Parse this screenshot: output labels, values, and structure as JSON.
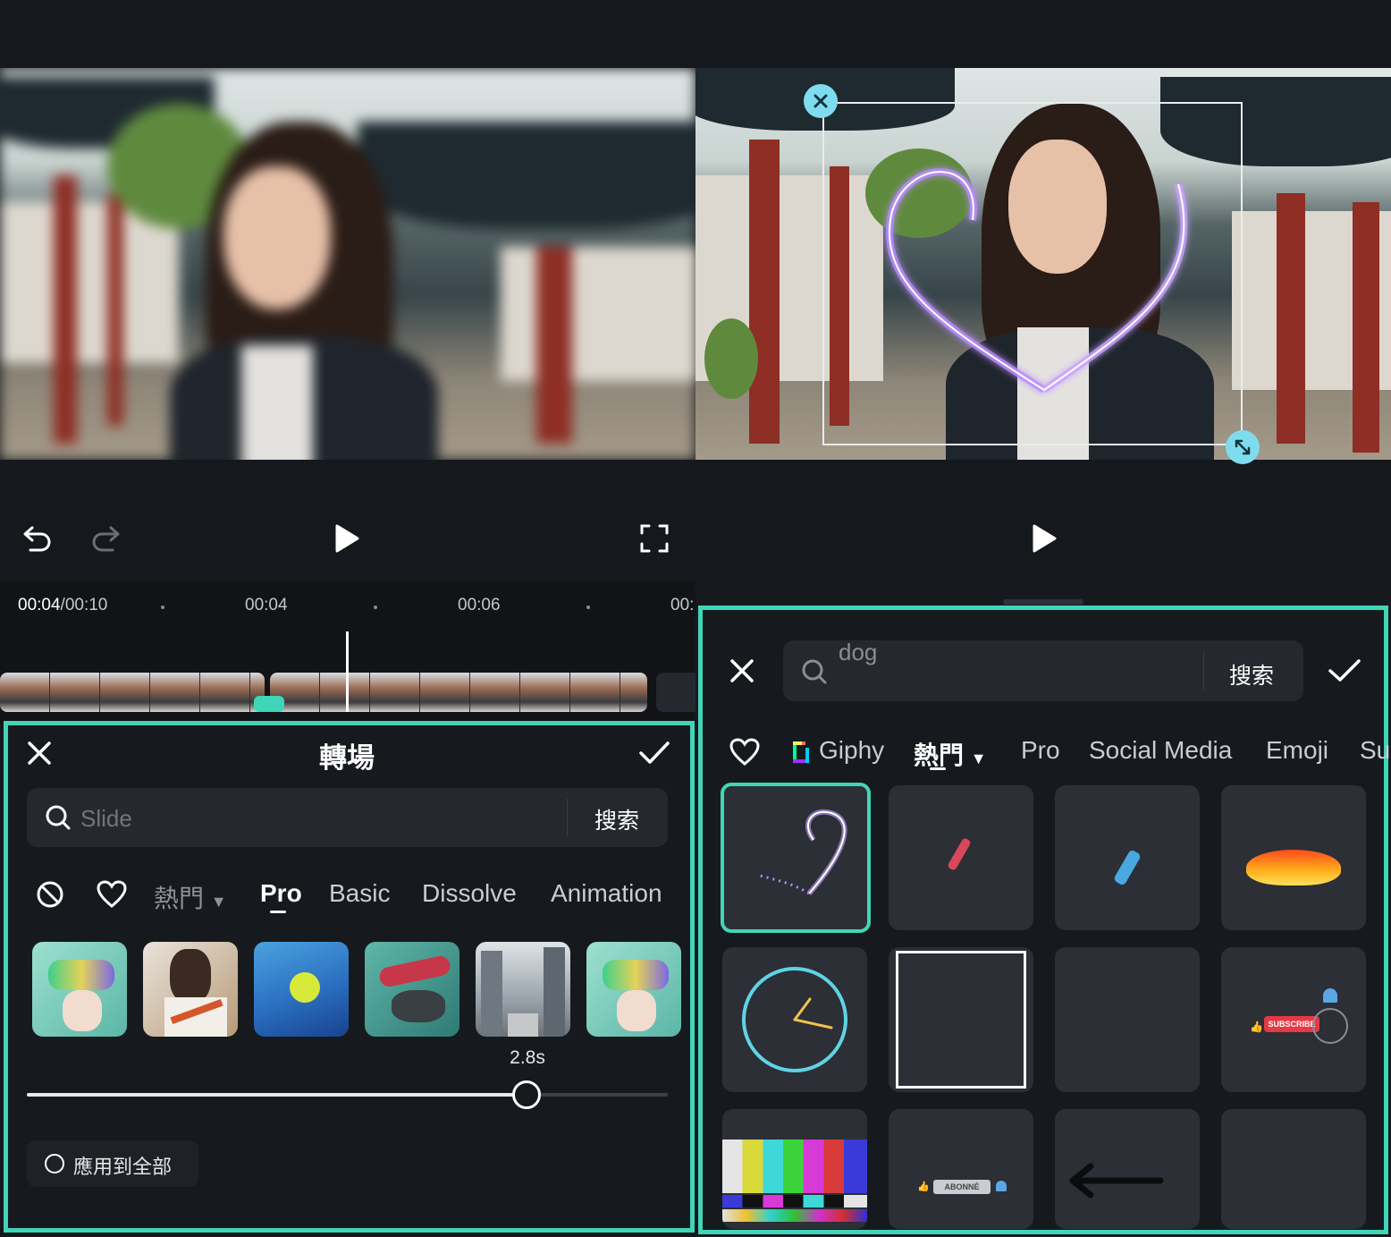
{
  "colors": {
    "accent": "#41d5b8",
    "handle": "#7fdcef",
    "panel_bg": "#16191e",
    "tile_bg": "#2c2f35"
  },
  "toolbar": {
    "undo_icon": "undo-icon",
    "redo_icon": "redo-icon",
    "play_icon": "play-icon",
    "fullscreen_icon": "fullscreen-icon"
  },
  "timeline": {
    "current": "00:04",
    "total": "/00:10",
    "ticks": [
      "00:04",
      "00:06",
      "00:"
    ]
  },
  "transition_panel": {
    "title": "轉場",
    "search_placeholder": "Slide",
    "search_button": "搜索",
    "filters": [
      "熱門",
      "Pro",
      "Basic",
      "Dissolve",
      "Animation"
    ],
    "active_filter": "Pro",
    "duration_label": "2.8s",
    "duration_fraction": 0.78,
    "apply_all_label": "應用到全部"
  },
  "sticker_panel": {
    "search_value": "dog",
    "search_button": "搜索",
    "tabs": [
      "Giphy",
      "熱門",
      "Pro",
      "Social Media",
      "Emoji",
      "Su"
    ],
    "subscribe_label": "SUBSCRIBE",
    "abonne_label": "ABONNÉ"
  }
}
